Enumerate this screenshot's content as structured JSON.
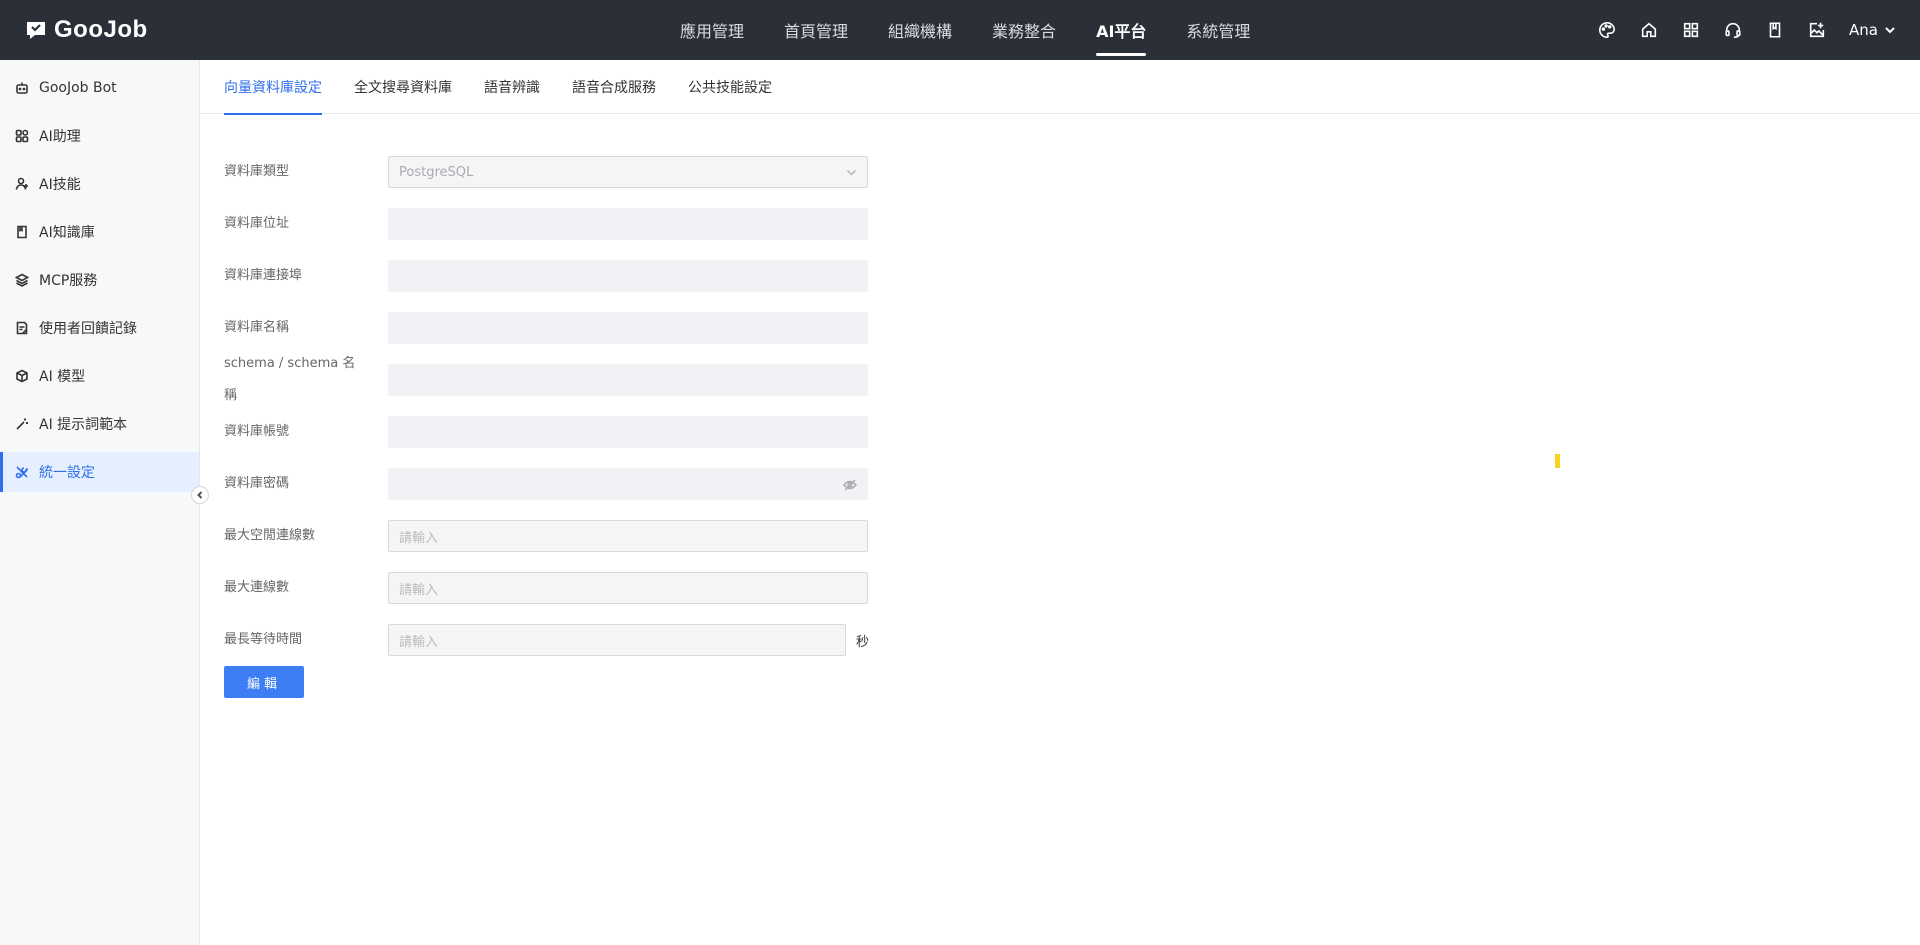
{
  "brand": {
    "name": "GooJob"
  },
  "topnav": [
    {
      "label": "應用管理",
      "active": false
    },
    {
      "label": "首頁管理",
      "active": false
    },
    {
      "label": "組織機構",
      "active": false
    },
    {
      "label": "業務整合",
      "active": false
    },
    {
      "label": "AI平台",
      "active": true
    },
    {
      "label": "系統管理",
      "active": false
    }
  ],
  "topright": {
    "icons": [
      "palette-icon",
      "home-icon",
      "grid-icon",
      "headset-icon",
      "book-icon",
      "image-edit-icon"
    ],
    "user": "Ana"
  },
  "sidebar": {
    "items": [
      {
        "label": "GooJob Bot",
        "icon": "robot-icon"
      },
      {
        "label": "AI助理",
        "icon": "apps-icon"
      },
      {
        "label": "AI技能",
        "icon": "skill-icon"
      },
      {
        "label": "AI知識庫",
        "icon": "book-icon"
      },
      {
        "label": "MCP服務",
        "icon": "layers-icon"
      },
      {
        "label": "使用者回饋記錄",
        "icon": "feedback-icon"
      },
      {
        "label": "AI 模型",
        "icon": "cube-icon"
      },
      {
        "label": "AI 提示詞範本",
        "icon": "magic-wand-icon"
      },
      {
        "label": "統一設定",
        "icon": "settings-cross-icon",
        "active": true
      }
    ]
  },
  "tabs": [
    {
      "label": "向量資料庫設定",
      "active": true
    },
    {
      "label": "全文搜尋資料庫",
      "active": false
    },
    {
      "label": "語音辨識",
      "active": false
    },
    {
      "label": "語音合成服務",
      "active": false
    },
    {
      "label": "公共技能設定",
      "active": false
    }
  ],
  "form": {
    "db_type": {
      "label": "資料庫類型",
      "value": "PostgreSQL"
    },
    "db_host": {
      "label": "資料庫位址",
      "value": ""
    },
    "db_port": {
      "label": "資料庫連接埠",
      "value": ""
    },
    "db_name": {
      "label": "資料庫名稱",
      "value": ""
    },
    "schema": {
      "label": "schema / schema 名稱",
      "value": ""
    },
    "db_user": {
      "label": "資料庫帳號",
      "value": ""
    },
    "db_password": {
      "label": "資料庫密碼",
      "value": ""
    },
    "max_idle": {
      "label": "最大空閒連線數",
      "placeholder": "請輸入"
    },
    "max_conn": {
      "label": "最大連線數",
      "placeholder": "請輸入"
    },
    "max_wait": {
      "label": "最長等待時間",
      "placeholder": "請輸入",
      "unit": "秒"
    },
    "edit_label": "編輯"
  },
  "colors": {
    "accent": "#3d7ef5",
    "topbar": "#2b2f38",
    "marker": "#f7d41e"
  }
}
